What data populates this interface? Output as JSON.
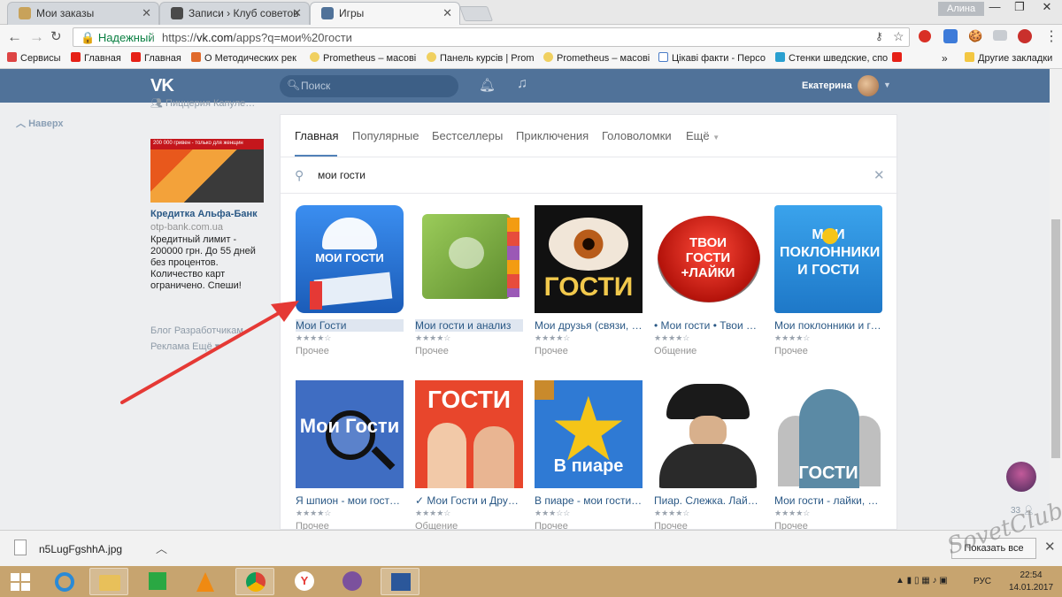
{
  "browser": {
    "tabs": [
      {
        "title": "Мои заказы",
        "color": "#c8a25a"
      },
      {
        "title": "Записи › Клуб советов",
        "color": "#4a4a4a"
      },
      {
        "title": "Игры",
        "color": "#507299"
      }
    ],
    "window_user": "Алина",
    "secure_label": "Надежный",
    "url_prefix": "https://",
    "url_host": "vk.com",
    "url_path": "/apps?q=мои%20гости",
    "bookmarks": [
      {
        "label": "Сервисы",
        "color": "#d44"
      },
      {
        "label": "Главная",
        "color": "#e62117"
      },
      {
        "label": "Главная",
        "color": "#e62117"
      },
      {
        "label": "О Методических рек",
        "color": "#e06a2c"
      },
      {
        "label": "Prometheus – масові",
        "color": "#f0d060"
      },
      {
        "label": "Панель курсів | Prom",
        "color": "#f0d060"
      },
      {
        "label": "Prometheus – масові",
        "color": "#f0d060"
      },
      {
        "label": "Цікаві факти - Персо",
        "color": "#4a7cc7"
      },
      {
        "label": "Стенки шведские, спо",
        "color": "#2aa0d0"
      },
      {
        "label": "",
        "color": "#e62117"
      }
    ],
    "bookmarks_more": "»",
    "other_bookmarks": "Другие закладки"
  },
  "vk": {
    "logo": "VK",
    "search_placeholder": "Поиск",
    "user_name": "Екатерина",
    "back_to_top": "Наверх",
    "side_group": "Пиццерия Капуле…",
    "ad": {
      "banner_text": "200 000 гривен - только для женщин",
      "title": "Кредитка Альфа-Банк",
      "site": "otp-bank.com.ua",
      "text": "Кредитный лимит - 200000 грн. До 55 дней без процентов. Количество карт ограничено. Спеши!"
    },
    "footer_links_1": "Блог   Разработчикам",
    "footer_links_2": "Реклама   Ещё ▾",
    "side_count": "33"
  },
  "games": {
    "tabs": [
      "Главная",
      "Популярные",
      "Бестселлеры",
      "Приключения",
      "Головоломки",
      "Ещё"
    ],
    "search_value": "мои гости",
    "apps": [
      {
        "title": "Мои Гости",
        "stars": "★★★★☆",
        "category": "Прочее",
        "img_text": "МОИ ГОСТИ",
        "bg": "#2a6fc9",
        "highlight": true
      },
      {
        "title": "Мои гости и анализ",
        "stars": "★★★★☆",
        "category": "Прочее",
        "img_text": "",
        "bg": "#7fae4a",
        "highlight": true
      },
      {
        "title": "Мои друзья (связи, г…",
        "stars": "★★★★☆",
        "category": "Прочее",
        "img_text": "ГОСТИ",
        "bg": "#151515",
        "highlight": false
      },
      {
        "title": "• Мои гости • Твои ла…",
        "stars": "★★★★☆",
        "category": "Общение",
        "img_text": "ТВОИ ГОСТИ +ЛАЙКИ",
        "bg": "#ffffff",
        "highlight": false
      },
      {
        "title": "Мои поклонники и го…",
        "stars": "★★★★☆",
        "category": "Прочее",
        "img_text": "МОИ ПОКЛОННИКИ И ГОСТИ",
        "bg": "#2d8fd6",
        "highlight": false
      },
      {
        "title": "Я шпион - мои гости, …",
        "stars": "★★★★☆",
        "category": "Прочее",
        "img_text": "Мои Гости",
        "bg": "#3f6dc2",
        "highlight": false
      },
      {
        "title": "✓ Мои Гости и Друзья",
        "stars": "★★★★☆",
        "category": "Общение",
        "img_text": "ГОСТИ",
        "bg": "#e8462c",
        "highlight": false
      },
      {
        "title": "В пиаре - мои гости, …",
        "stars": "★★★☆☆",
        "category": "Прочее",
        "img_text": "В пиаре",
        "bg": "#2f7ad4",
        "highlight": false
      },
      {
        "title": "Пиар. Слежка. Лайк…",
        "stars": "★★★★☆",
        "category": "Прочее",
        "img_text": "",
        "bg": "#ffffff",
        "highlight": false
      },
      {
        "title": "Мои гости - лайки, д…",
        "stars": "★★★★☆",
        "category": "Прочее",
        "img_text": "ГОСТИ",
        "bg": "#ffffff",
        "highlight": false
      }
    ]
  },
  "downloads": {
    "file_name": "n5LugFgshhA.jpg",
    "show_all": "Показать все"
  },
  "taskbar": {
    "lang": "РУС",
    "time": "22:54",
    "date": "14.01.2017"
  },
  "watermark": "SovetClub",
  "colors": {
    "vk_blue": "#507299",
    "link": "#2a5885",
    "arrow": "#e53935"
  }
}
